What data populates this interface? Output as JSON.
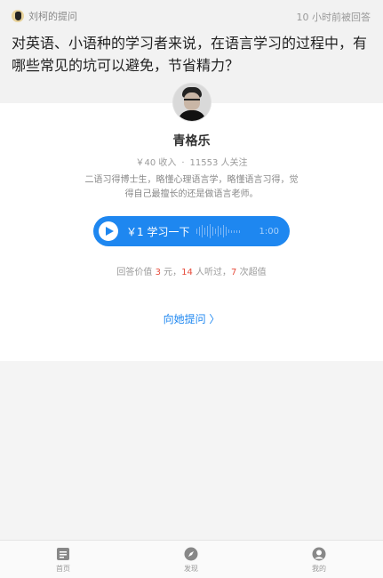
{
  "question": {
    "asker": "刘柯的提问",
    "time": "10 小时前被回答",
    "text": "对英语、小语种的学习者来说，在语言学习的过程中，有哪些常见的坑可以避免，节省精力？"
  },
  "answerer": {
    "name": "青格乐",
    "income": "￥40 收入",
    "followers": "11553 人关注",
    "bio": "二语习得博士生，略懂心理语言学，略懂语言习得，觉得自己最擅长的还是做语言老师。"
  },
  "audio": {
    "label": "￥1 学习一下",
    "duration": "1:00"
  },
  "value_line": {
    "prefix": "回答价值 ",
    "price": "3",
    "sep1": " 元，",
    "listeners": "14",
    "sep2": " 人听过，",
    "worth": "7",
    "suffix": " 次超值"
  },
  "ask_link": "向她提问 〉",
  "tabbar": {
    "home": "首页",
    "discover": "发现",
    "mine": "我的"
  },
  "colors": {
    "accent": "#1e87f0",
    "highlight": "#e74c3c"
  }
}
